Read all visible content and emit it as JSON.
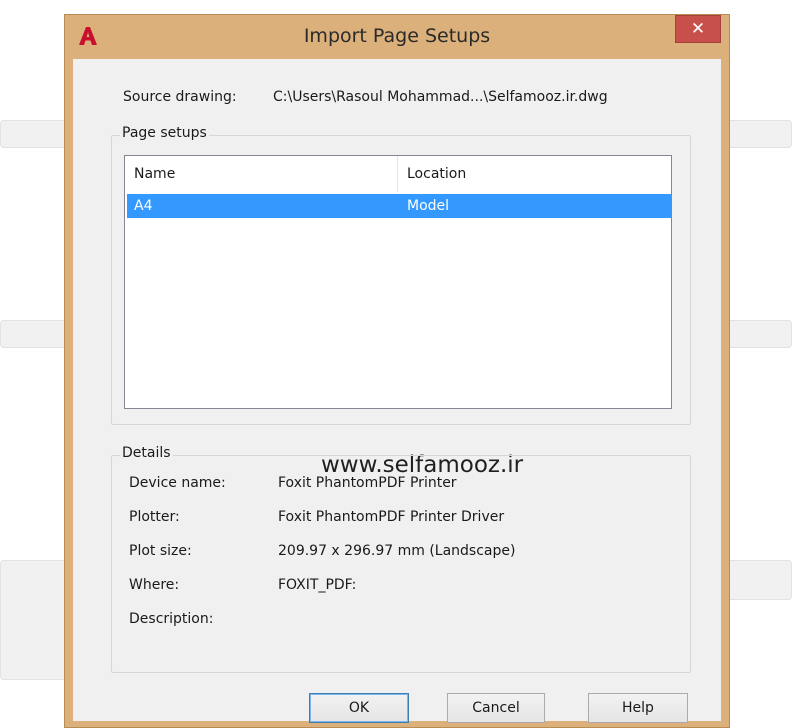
{
  "window": {
    "title": "Import Page Setups",
    "close_symbol": "✕"
  },
  "source": {
    "label": "Source drawing:",
    "value": "C:\\Users\\Rasoul Mohammad...\\Selfamooz.ir.dwg"
  },
  "page_setups": {
    "group_label": "Page setups",
    "columns": [
      "Name",
      "Location"
    ],
    "rows": [
      {
        "name": "A4",
        "location": "Model"
      }
    ]
  },
  "watermark": "www.selfamooz.ir",
  "details": {
    "group_label": "Details",
    "items": [
      {
        "label": "Device name:",
        "value": "Foxit PhantomPDF Printer"
      },
      {
        "label": "Plotter:",
        "value": "Foxit PhantomPDF Printer Driver"
      },
      {
        "label": "Plot size:",
        "value": "209.97 x 296.97 mm (Landscape)"
      },
      {
        "label": "Where:",
        "value": "FOXIT_PDF:"
      },
      {
        "label": "Description:",
        "value": ""
      }
    ]
  },
  "buttons": {
    "ok": "OK",
    "cancel": "Cancel",
    "help": "Help"
  },
  "colors": {
    "titlebar": "#dbb07a",
    "selection": "#3399ff",
    "close": "#c7504a"
  },
  "icons": {
    "app": "autocad-logo-icon",
    "close": "close-icon"
  }
}
